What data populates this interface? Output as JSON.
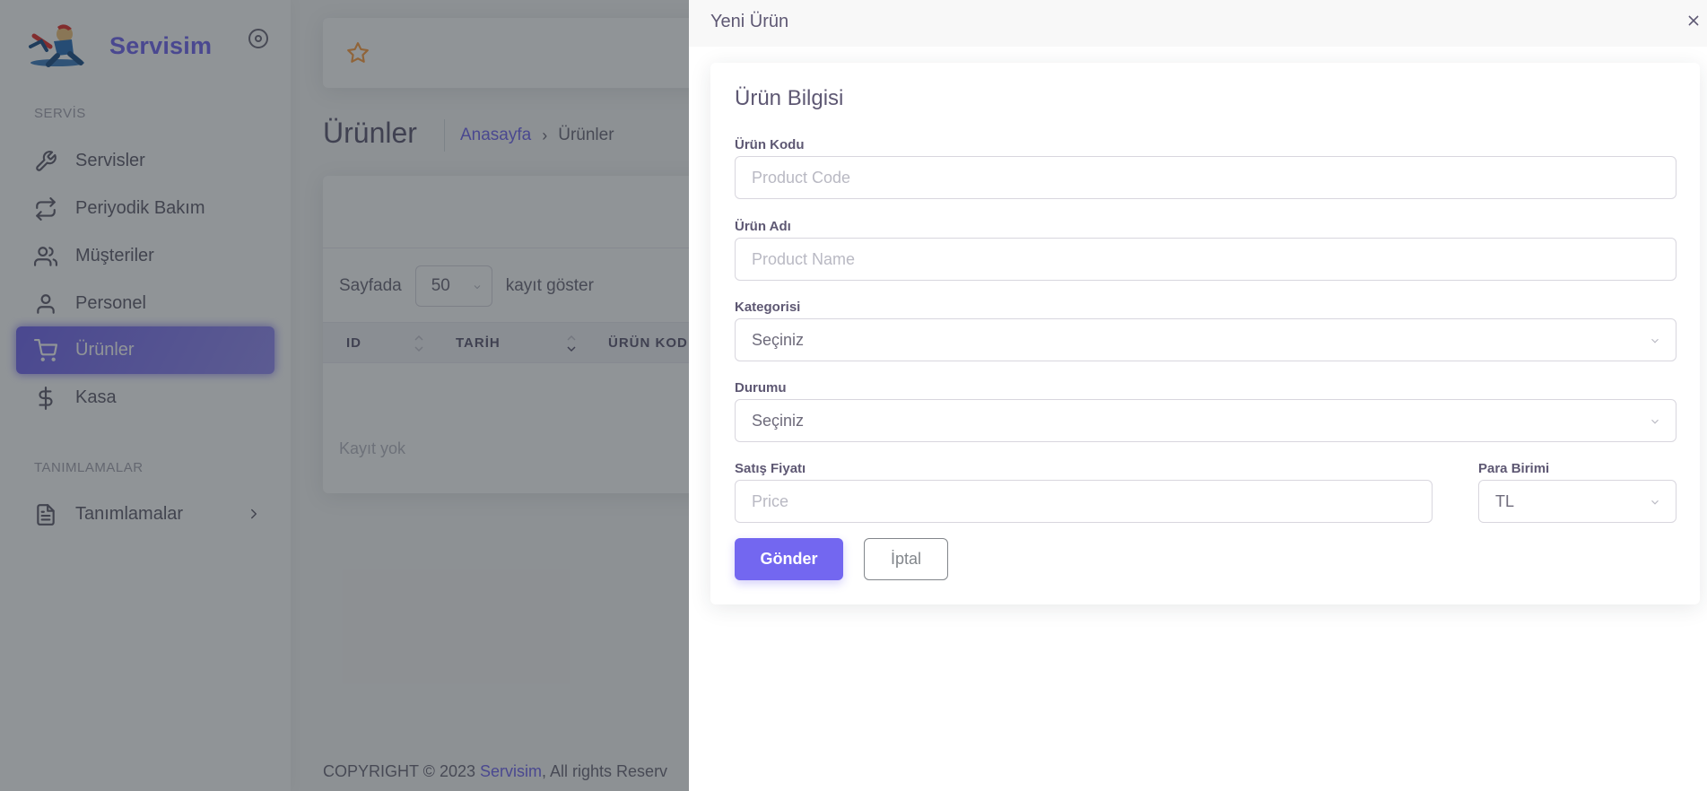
{
  "colors": {
    "primary": "#7367f0",
    "overlay": "rgba(34,41,47,0.5)"
  },
  "sidebar": {
    "brand_name": "Servisim",
    "sections": [
      {
        "header": "SERVİS"
      },
      {
        "header": "TANIMLAMALAR"
      }
    ],
    "items": [
      {
        "label": "Servisler",
        "icon": "wrench-icon"
      },
      {
        "label": "Periyodik Bakım",
        "icon": "repeat-icon"
      },
      {
        "label": "Müşteriler",
        "icon": "users-icon"
      },
      {
        "label": "Personel",
        "icon": "user-icon"
      },
      {
        "label": "Ürünler",
        "icon": "cart-icon",
        "active": true
      },
      {
        "label": "Kasa",
        "icon": "dollar-icon"
      },
      {
        "label": "Tanımlamalar",
        "icon": "file-text-icon",
        "has_submenu": true
      }
    ]
  },
  "main": {
    "page_title": "Ürünler",
    "breadcrumb": {
      "home": "Anasayfa",
      "separator": "›",
      "current": "Ürünler"
    },
    "table": {
      "length_prefix": "Sayfada",
      "length_value": "50",
      "length_suffix": "kayıt göster",
      "columns": [
        "ID",
        "TARİH",
        "ÜRÜN KOD"
      ],
      "empty_text": "Kayıt yok"
    },
    "footer": {
      "prefix": "COPYRIGHT © 2023 ",
      "brand": "Servisim",
      "suffix": ", All rights Reserv"
    }
  },
  "modal": {
    "title": "Yeni Ürün",
    "close_symbol": "×",
    "card_title": "Ürün Bilgisi",
    "fields": {
      "code": {
        "label": "Ürün Kodu",
        "placeholder": "Product Code"
      },
      "name": {
        "label": "Ürün Adı",
        "placeholder": "Product Name"
      },
      "category": {
        "label": "Kategorisi",
        "value": "Seçiniz"
      },
      "status": {
        "label": "Durumu",
        "value": "Seçiniz"
      },
      "price": {
        "label": "Satış Fiyatı",
        "placeholder": "Price"
      },
      "currency": {
        "label": "Para Birimi",
        "value": "TL"
      }
    },
    "submit_label": "Gönder",
    "cancel_label": "İptal"
  }
}
